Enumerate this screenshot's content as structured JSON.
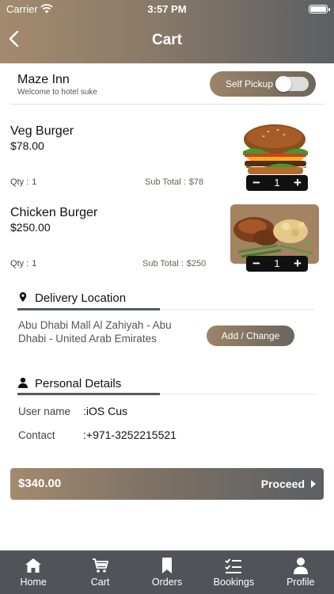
{
  "status_bar": {
    "carrier": "Carrier",
    "time": "3:57 PM"
  },
  "header": {
    "title": "Cart"
  },
  "hotel": {
    "name": "Maze Inn",
    "subtitle": "Welcome to hotel suke"
  },
  "pickup": {
    "label": "Self Pickup",
    "enabled": false
  },
  "items": [
    {
      "name": "Veg Burger",
      "price": "$78.00",
      "qty_label": "Qty :",
      "qty": "1",
      "subtotal_label": "Sub Total :",
      "subtotal": "$78",
      "count": "1",
      "image": "burger-image"
    },
    {
      "name": "Chicken Burger",
      "price": "$250.00",
      "qty_label": "Qty :",
      "qty": "1",
      "subtotal_label": "Sub Total :",
      "subtotal": "$250",
      "count": "1",
      "image": "chicken-platter-image"
    }
  ],
  "stepper": {
    "minus": "−",
    "plus": "+"
  },
  "delivery": {
    "title": "Delivery Location",
    "address": "Abu Dhabi Mall Al Zahiyah - Abu Dhabi - United Arab Emirates",
    "button": "Add / Change"
  },
  "personal": {
    "title": "Personal Details",
    "rows": [
      {
        "label": "User name",
        "value": ":iOS Cus"
      },
      {
        "label": "Contact",
        "value": ":+971-3252215521"
      }
    ]
  },
  "checkout": {
    "total": "$340.00",
    "proceed": "Proceed"
  },
  "tabs": [
    {
      "label": "Home",
      "icon": "home-icon"
    },
    {
      "label": "Cart",
      "icon": "cart-icon"
    },
    {
      "label": "Orders",
      "icon": "bookmark-icon"
    },
    {
      "label": "Bookings",
      "icon": "checklist-icon"
    },
    {
      "label": "Profile",
      "icon": "person-icon"
    }
  ],
  "colors": {
    "accent_start": "#a48a6e",
    "accent_end": "#5c5f64",
    "tabbar": "#505459"
  }
}
